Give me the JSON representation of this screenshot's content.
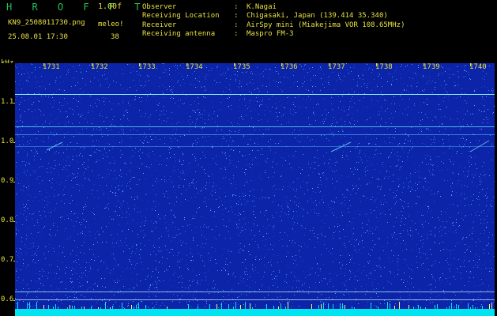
{
  "header": {
    "app_title": "H R O F F T",
    "version": "1.00f",
    "filename": "KN9_2508011730.png",
    "mode": "meleo!",
    "datetime": "25.08.01 17:30",
    "count": "38"
  },
  "info": [
    {
      "key": "Observer",
      "value": "K.Nagai"
    },
    {
      "key": "Receiving Location",
      "value": "Chigasaki, Japan (139.414 35.340)"
    },
    {
      "key": "Receiver",
      "value": "AirSpy mini (Miakejima VOR 108.65MHz)"
    },
    {
      "key": "Receiving antenna",
      "value": "Maspro FM-3"
    }
  ],
  "spectrogram": {
    "unit": "kHz",
    "freq_labels": [
      "1.1",
      "1.0",
      "0.9",
      "0.8",
      "0.7",
      "0.6"
    ],
    "time_labels": [
      "1731",
      "1732",
      "1733",
      "1734",
      "1735",
      "1736",
      "1737",
      "1738",
      "1739",
      "1740"
    ],
    "colors": {
      "background": "#0b24a8",
      "noise": "#3a7cff",
      "signal": "#7cf0ff",
      "baseline": "#00e4f0",
      "text": "#e8e040"
    }
  }
}
